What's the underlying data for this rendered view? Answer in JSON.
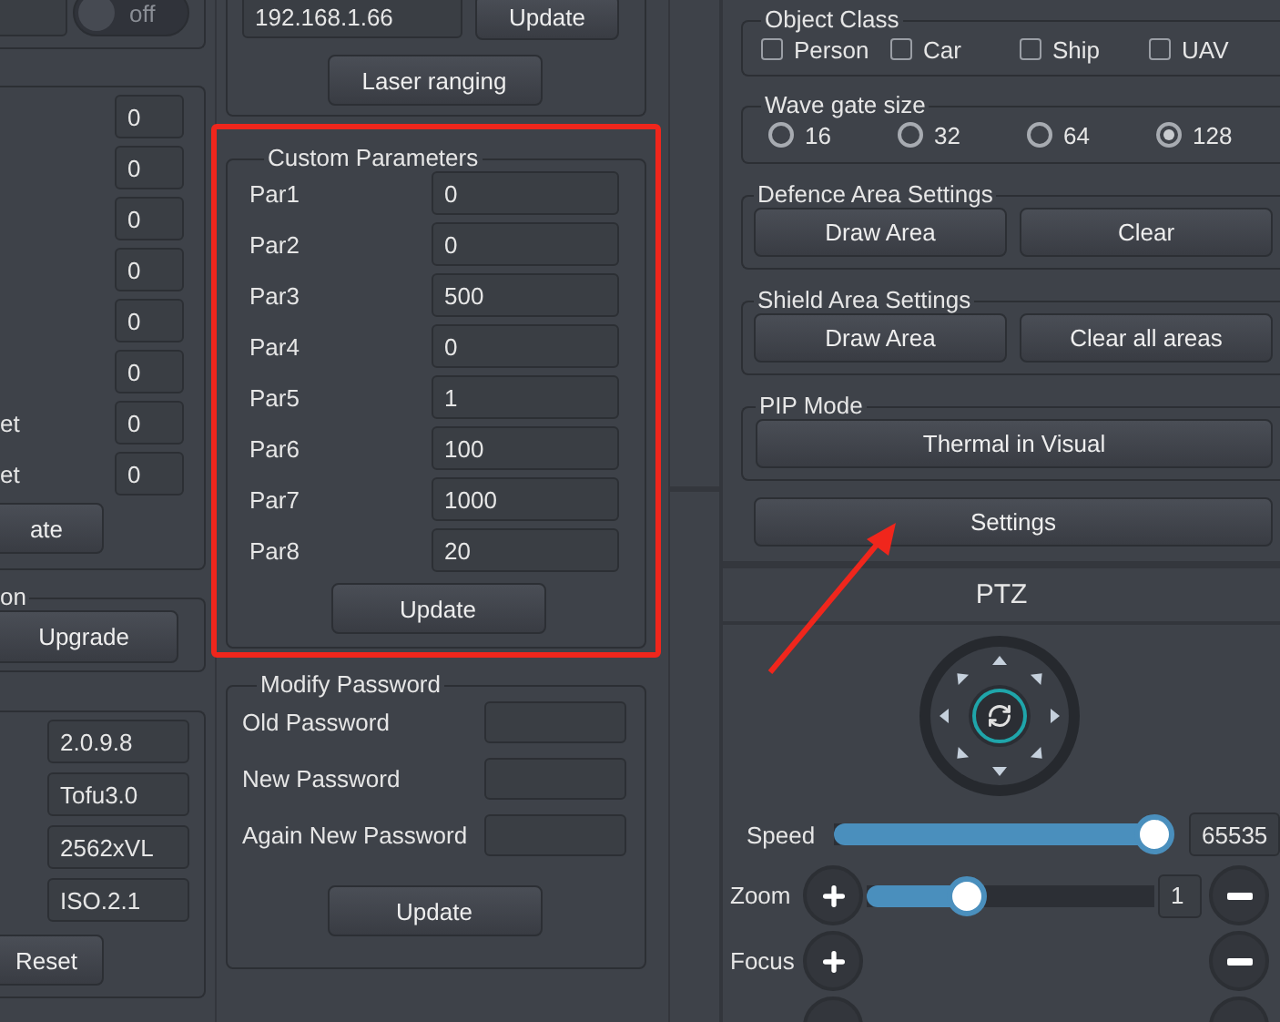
{
  "left_panel": {
    "toggle": {
      "label": "off",
      "on": false
    },
    "offset_rows": [
      {
        "value": "0"
      },
      {
        "value": "0"
      },
      {
        "value": "0"
      },
      {
        "value": "0"
      },
      {
        "value": "0"
      },
      {
        "value": "0"
      },
      {
        "label": "et",
        "value": "0"
      },
      {
        "label": "et",
        "value": "0"
      }
    ],
    "update_button": "ate",
    "upgrade_group": {
      "title": "on",
      "button": "Upgrade"
    },
    "version_fields": [
      "2.0.9.8",
      "Tofu3.0",
      "2562xVL",
      "ISO.2.1"
    ],
    "reset_button": "Reset"
  },
  "middle_panel": {
    "ip_field": "192.168.1.66",
    "ip_update_button": "Update",
    "laser_button": "Laser ranging",
    "custom_parameters": {
      "title": "Custom Parameters",
      "rows": [
        {
          "label": "Par1",
          "value": "0"
        },
        {
          "label": "Par2",
          "value": "0"
        },
        {
          "label": "Par3",
          "value": "500"
        },
        {
          "label": "Par4",
          "value": "0"
        },
        {
          "label": "Par5",
          "value": "1"
        },
        {
          "label": "Par6",
          "value": "100"
        },
        {
          "label": "Par7",
          "value": "1000"
        },
        {
          "label": "Par8",
          "value": "20"
        }
      ],
      "button": "Update"
    },
    "modify_password": {
      "title": "Modify Password",
      "fields": [
        {
          "label": "Old Password"
        },
        {
          "label": "New Password"
        },
        {
          "label": "Again New Password"
        }
      ],
      "button": "Update"
    }
  },
  "right_panel": {
    "object_class": {
      "title": "Object Class",
      "options": [
        {
          "label": "Person",
          "checked": false
        },
        {
          "label": "Car",
          "checked": false
        },
        {
          "label": "Ship",
          "checked": false
        },
        {
          "label": "UAV",
          "checked": false
        }
      ]
    },
    "wave_gate_size": {
      "title": "Wave gate size",
      "options": [
        {
          "label": "16",
          "selected": false
        },
        {
          "label": "32",
          "selected": false
        },
        {
          "label": "64",
          "selected": false
        },
        {
          "label": "128",
          "selected": true
        }
      ]
    },
    "defence_area": {
      "title": "Defence Area Settings",
      "buttons": [
        "Draw Area",
        "Clear"
      ]
    },
    "shield_area": {
      "title": "Shield Area Settings",
      "buttons": [
        "Draw Area",
        "Clear all areas"
      ]
    },
    "pip_mode": {
      "title": "PIP Mode",
      "button": "Thermal in Visual"
    },
    "settings_button": "Settings",
    "ptz": {
      "title": "PTZ",
      "speed": {
        "label": "Speed",
        "level": 0.95,
        "reading": "65535"
      },
      "zoom": {
        "label": "Zoom",
        "level": 0.35,
        "reading": "1"
      },
      "focus": {
        "label": "Focus"
      }
    }
  }
}
